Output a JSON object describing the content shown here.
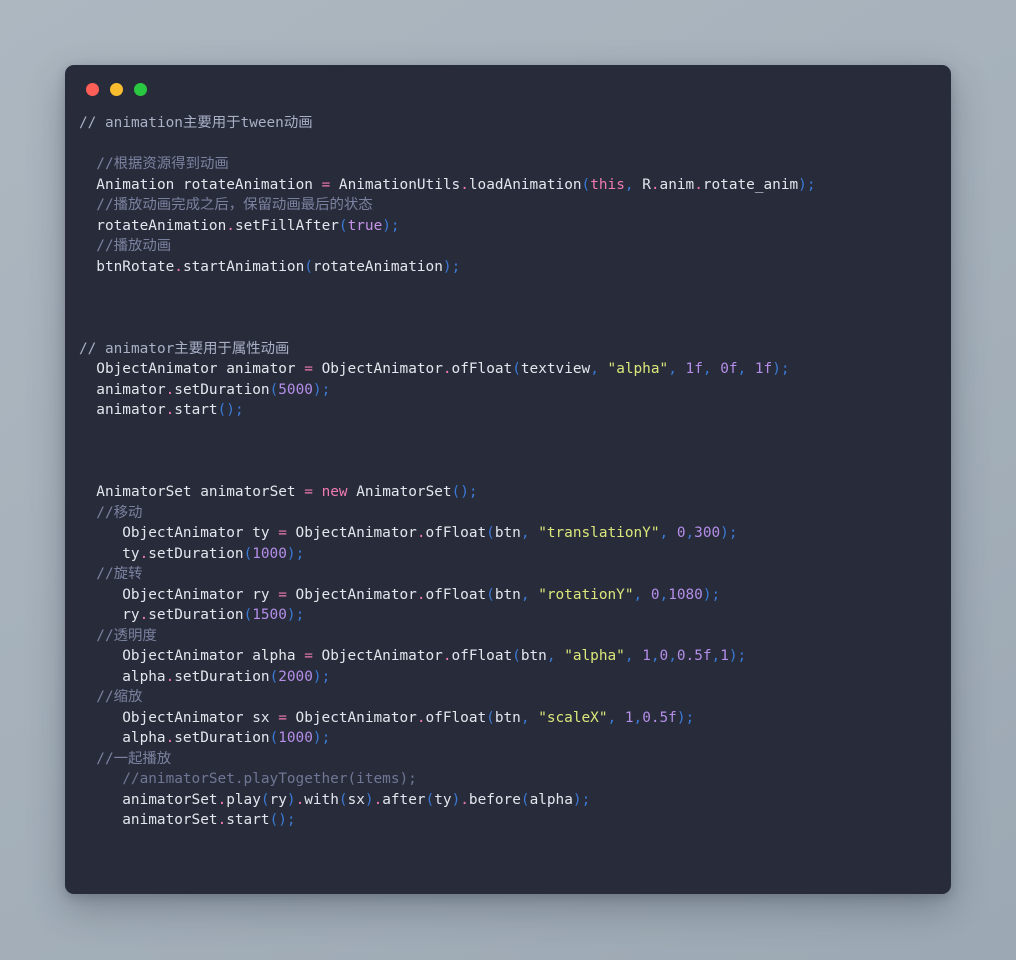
{
  "window": {
    "title": "code-editor-window",
    "traffic_lights": [
      {
        "name": "close-button",
        "color": "#ff5f57"
      },
      {
        "name": "minimize-button",
        "color": "#f7bd2e"
      },
      {
        "name": "maximize-button",
        "color": "#2ac840"
      }
    ],
    "background": "#282c3a",
    "page_background": "#a6b1bb"
  },
  "code": {
    "language": "java",
    "lines": [
      {
        "indent": 0,
        "tokens": [
          {
            "t": "// animation主要用于tween动画",
            "c": "c-comment2"
          }
        ]
      },
      {
        "indent": 0,
        "tokens": []
      },
      {
        "indent": 2,
        "tokens": [
          {
            "t": "//根据资源得到动画",
            "c": "c-comment"
          }
        ]
      },
      {
        "indent": 2,
        "tokens": [
          {
            "t": "Animation",
            "c": "c-plain"
          },
          {
            "t": " rotateAnimation ",
            "c": "c-plain"
          },
          {
            "t": "=",
            "c": "c-op"
          },
          {
            "t": " AnimationUtils",
            "c": "c-plain"
          },
          {
            "t": ".",
            "c": "c-dot"
          },
          {
            "t": "loadAnimation",
            "c": "c-plain"
          },
          {
            "t": "(",
            "c": "c-punct"
          },
          {
            "t": "this",
            "c": "c-kw"
          },
          {
            "t": ",",
            "c": "c-punct"
          },
          {
            "t": " R",
            "c": "c-plain"
          },
          {
            "t": ".",
            "c": "c-dot"
          },
          {
            "t": "anim",
            "c": "c-plain"
          },
          {
            "t": ".",
            "c": "c-dot"
          },
          {
            "t": "rotate_anim",
            "c": "c-plain"
          },
          {
            "t": ")",
            "c": "c-punct"
          },
          {
            "t": ";",
            "c": "c-punct"
          }
        ]
      },
      {
        "indent": 2,
        "tokens": [
          {
            "t": "//播放动画完成之后，保留动画最后的状态",
            "c": "c-comment"
          }
        ]
      },
      {
        "indent": 2,
        "tokens": [
          {
            "t": "rotateAnimation",
            "c": "c-plain"
          },
          {
            "t": ".",
            "c": "c-dot"
          },
          {
            "t": "setFillAfter",
            "c": "c-plain"
          },
          {
            "t": "(",
            "c": "c-punct"
          },
          {
            "t": "true",
            "c": "c-kw2"
          },
          {
            "t": ")",
            "c": "c-punct"
          },
          {
            "t": ";",
            "c": "c-punct"
          }
        ]
      },
      {
        "indent": 2,
        "tokens": [
          {
            "t": "//播放动画",
            "c": "c-comment"
          }
        ]
      },
      {
        "indent": 2,
        "tokens": [
          {
            "t": "btnRotate",
            "c": "c-plain"
          },
          {
            "t": ".",
            "c": "c-dot"
          },
          {
            "t": "startAnimation",
            "c": "c-plain"
          },
          {
            "t": "(",
            "c": "c-punct"
          },
          {
            "t": "rotateAnimation",
            "c": "c-plain"
          },
          {
            "t": ")",
            "c": "c-punct"
          },
          {
            "t": ";",
            "c": "c-punct"
          }
        ]
      },
      {
        "indent": 0,
        "tokens": []
      },
      {
        "indent": 0,
        "tokens": []
      },
      {
        "indent": 0,
        "tokens": []
      },
      {
        "indent": 0,
        "tokens": [
          {
            "t": "// animator主要用于属性动画",
            "c": "c-comment2"
          }
        ]
      },
      {
        "indent": 2,
        "tokens": [
          {
            "t": "ObjectAnimator",
            "c": "c-plain"
          },
          {
            "t": " animator ",
            "c": "c-plain"
          },
          {
            "t": "=",
            "c": "c-op"
          },
          {
            "t": " ObjectAnimator",
            "c": "c-plain"
          },
          {
            "t": ".",
            "c": "c-dot"
          },
          {
            "t": "ofFloat",
            "c": "c-plain"
          },
          {
            "t": "(",
            "c": "c-punct"
          },
          {
            "t": "textview",
            "c": "c-plain"
          },
          {
            "t": ",",
            "c": "c-punct"
          },
          {
            "t": " ",
            "c": "c-plain"
          },
          {
            "t": "\"alpha\"",
            "c": "c-str"
          },
          {
            "t": ",",
            "c": "c-punct"
          },
          {
            "t": " ",
            "c": "c-plain"
          },
          {
            "t": "1f",
            "c": "c-num"
          },
          {
            "t": ",",
            "c": "c-punct"
          },
          {
            "t": " ",
            "c": "c-plain"
          },
          {
            "t": "0f",
            "c": "c-num"
          },
          {
            "t": ",",
            "c": "c-punct"
          },
          {
            "t": " ",
            "c": "c-plain"
          },
          {
            "t": "1f",
            "c": "c-num"
          },
          {
            "t": ")",
            "c": "c-punct"
          },
          {
            "t": ";",
            "c": "c-punct"
          }
        ]
      },
      {
        "indent": 2,
        "tokens": [
          {
            "t": "animator",
            "c": "c-plain"
          },
          {
            "t": ".",
            "c": "c-dot"
          },
          {
            "t": "setDuration",
            "c": "c-plain"
          },
          {
            "t": "(",
            "c": "c-punct"
          },
          {
            "t": "5000",
            "c": "c-num"
          },
          {
            "t": ")",
            "c": "c-punct"
          },
          {
            "t": ";",
            "c": "c-punct"
          }
        ]
      },
      {
        "indent": 2,
        "tokens": [
          {
            "t": "animator",
            "c": "c-plain"
          },
          {
            "t": ".",
            "c": "c-dot"
          },
          {
            "t": "start",
            "c": "c-plain"
          },
          {
            "t": "(",
            "c": "c-punct"
          },
          {
            "t": ")",
            "c": "c-punct"
          },
          {
            "t": ";",
            "c": "c-punct"
          }
        ]
      },
      {
        "indent": 0,
        "tokens": []
      },
      {
        "indent": 0,
        "tokens": []
      },
      {
        "indent": 0,
        "tokens": []
      },
      {
        "indent": 2,
        "tokens": [
          {
            "t": "AnimatorSet",
            "c": "c-plain"
          },
          {
            "t": " animatorSet ",
            "c": "c-plain"
          },
          {
            "t": "=",
            "c": "c-op"
          },
          {
            "t": " ",
            "c": "c-plain"
          },
          {
            "t": "new",
            "c": "c-kw"
          },
          {
            "t": " AnimatorSet",
            "c": "c-plain"
          },
          {
            "t": "(",
            "c": "c-punct"
          },
          {
            "t": ")",
            "c": "c-punct"
          },
          {
            "t": ";",
            "c": "c-punct"
          }
        ]
      },
      {
        "indent": 2,
        "tokens": [
          {
            "t": "//移动",
            "c": "c-comment"
          }
        ]
      },
      {
        "indent": 5,
        "tokens": [
          {
            "t": "ObjectAnimator",
            "c": "c-plain"
          },
          {
            "t": " ty ",
            "c": "c-plain"
          },
          {
            "t": "=",
            "c": "c-op"
          },
          {
            "t": " ObjectAnimator",
            "c": "c-plain"
          },
          {
            "t": ".",
            "c": "c-dot"
          },
          {
            "t": "ofFloat",
            "c": "c-plain"
          },
          {
            "t": "(",
            "c": "c-punct"
          },
          {
            "t": "btn",
            "c": "c-plain"
          },
          {
            "t": ",",
            "c": "c-punct"
          },
          {
            "t": " ",
            "c": "c-plain"
          },
          {
            "t": "\"translationY\"",
            "c": "c-str"
          },
          {
            "t": ",",
            "c": "c-punct"
          },
          {
            "t": " ",
            "c": "c-plain"
          },
          {
            "t": "0",
            "c": "c-num"
          },
          {
            "t": ",",
            "c": "c-punct"
          },
          {
            "t": "300",
            "c": "c-num"
          },
          {
            "t": ")",
            "c": "c-punct"
          },
          {
            "t": ";",
            "c": "c-punct"
          }
        ]
      },
      {
        "indent": 5,
        "tokens": [
          {
            "t": "ty",
            "c": "c-plain"
          },
          {
            "t": ".",
            "c": "c-dot"
          },
          {
            "t": "setDuration",
            "c": "c-plain"
          },
          {
            "t": "(",
            "c": "c-punct"
          },
          {
            "t": "1000",
            "c": "c-num"
          },
          {
            "t": ")",
            "c": "c-punct"
          },
          {
            "t": ";",
            "c": "c-punct"
          }
        ]
      },
      {
        "indent": 2,
        "tokens": [
          {
            "t": "//旋转",
            "c": "c-comment"
          }
        ]
      },
      {
        "indent": 5,
        "tokens": [
          {
            "t": "ObjectAnimator",
            "c": "c-plain"
          },
          {
            "t": " ry ",
            "c": "c-plain"
          },
          {
            "t": "=",
            "c": "c-op"
          },
          {
            "t": " ObjectAnimator",
            "c": "c-plain"
          },
          {
            "t": ".",
            "c": "c-dot"
          },
          {
            "t": "ofFloat",
            "c": "c-plain"
          },
          {
            "t": "(",
            "c": "c-punct"
          },
          {
            "t": "btn",
            "c": "c-plain"
          },
          {
            "t": ",",
            "c": "c-punct"
          },
          {
            "t": " ",
            "c": "c-plain"
          },
          {
            "t": "\"rotationY\"",
            "c": "c-str"
          },
          {
            "t": ",",
            "c": "c-punct"
          },
          {
            "t": " ",
            "c": "c-plain"
          },
          {
            "t": "0",
            "c": "c-num"
          },
          {
            "t": ",",
            "c": "c-punct"
          },
          {
            "t": "1080",
            "c": "c-num"
          },
          {
            "t": ")",
            "c": "c-punct"
          },
          {
            "t": ";",
            "c": "c-punct"
          }
        ]
      },
      {
        "indent": 5,
        "tokens": [
          {
            "t": "ry",
            "c": "c-plain"
          },
          {
            "t": ".",
            "c": "c-dot"
          },
          {
            "t": "setDuration",
            "c": "c-plain"
          },
          {
            "t": "(",
            "c": "c-punct"
          },
          {
            "t": "1500",
            "c": "c-num"
          },
          {
            "t": ")",
            "c": "c-punct"
          },
          {
            "t": ";",
            "c": "c-punct"
          }
        ]
      },
      {
        "indent": 2,
        "tokens": [
          {
            "t": "//透明度",
            "c": "c-comment"
          }
        ]
      },
      {
        "indent": 5,
        "tokens": [
          {
            "t": "ObjectAnimator",
            "c": "c-plain"
          },
          {
            "t": " alpha ",
            "c": "c-plain"
          },
          {
            "t": "=",
            "c": "c-op"
          },
          {
            "t": " ObjectAnimator",
            "c": "c-plain"
          },
          {
            "t": ".",
            "c": "c-dot"
          },
          {
            "t": "ofFloat",
            "c": "c-plain"
          },
          {
            "t": "(",
            "c": "c-punct"
          },
          {
            "t": "btn",
            "c": "c-plain"
          },
          {
            "t": ",",
            "c": "c-punct"
          },
          {
            "t": " ",
            "c": "c-plain"
          },
          {
            "t": "\"alpha\"",
            "c": "c-str"
          },
          {
            "t": ",",
            "c": "c-punct"
          },
          {
            "t": " ",
            "c": "c-plain"
          },
          {
            "t": "1",
            "c": "c-num"
          },
          {
            "t": ",",
            "c": "c-punct"
          },
          {
            "t": "0",
            "c": "c-num"
          },
          {
            "t": ",",
            "c": "c-punct"
          },
          {
            "t": "0.5f",
            "c": "c-num"
          },
          {
            "t": ",",
            "c": "c-punct"
          },
          {
            "t": "1",
            "c": "c-num"
          },
          {
            "t": ")",
            "c": "c-punct"
          },
          {
            "t": ";",
            "c": "c-punct"
          }
        ]
      },
      {
        "indent": 5,
        "tokens": [
          {
            "t": "alpha",
            "c": "c-plain"
          },
          {
            "t": ".",
            "c": "c-dot"
          },
          {
            "t": "setDuration",
            "c": "c-plain"
          },
          {
            "t": "(",
            "c": "c-punct"
          },
          {
            "t": "2000",
            "c": "c-num"
          },
          {
            "t": ")",
            "c": "c-punct"
          },
          {
            "t": ";",
            "c": "c-punct"
          }
        ]
      },
      {
        "indent": 2,
        "tokens": [
          {
            "t": "//缩放",
            "c": "c-comment"
          }
        ]
      },
      {
        "indent": 5,
        "tokens": [
          {
            "t": "ObjectAnimator",
            "c": "c-plain"
          },
          {
            "t": " sx ",
            "c": "c-plain"
          },
          {
            "t": "=",
            "c": "c-op"
          },
          {
            "t": " ObjectAnimator",
            "c": "c-plain"
          },
          {
            "t": ".",
            "c": "c-dot"
          },
          {
            "t": "ofFloat",
            "c": "c-plain"
          },
          {
            "t": "(",
            "c": "c-punct"
          },
          {
            "t": "btn",
            "c": "c-plain"
          },
          {
            "t": ",",
            "c": "c-punct"
          },
          {
            "t": " ",
            "c": "c-plain"
          },
          {
            "t": "\"scaleX\"",
            "c": "c-str"
          },
          {
            "t": ",",
            "c": "c-punct"
          },
          {
            "t": " ",
            "c": "c-plain"
          },
          {
            "t": "1",
            "c": "c-num"
          },
          {
            "t": ",",
            "c": "c-punct"
          },
          {
            "t": "0.5f",
            "c": "c-num"
          },
          {
            "t": ")",
            "c": "c-punct"
          },
          {
            "t": ";",
            "c": "c-punct"
          }
        ]
      },
      {
        "indent": 5,
        "tokens": [
          {
            "t": "alpha",
            "c": "c-plain"
          },
          {
            "t": ".",
            "c": "c-dot"
          },
          {
            "t": "setDuration",
            "c": "c-plain"
          },
          {
            "t": "(",
            "c": "c-punct"
          },
          {
            "t": "1000",
            "c": "c-num"
          },
          {
            "t": ")",
            "c": "c-punct"
          },
          {
            "t": ";",
            "c": "c-punct"
          }
        ]
      },
      {
        "indent": 2,
        "tokens": [
          {
            "t": "//一起播放",
            "c": "c-comment"
          }
        ]
      },
      {
        "indent": 5,
        "tokens": [
          {
            "t": "//animatorSet.playTogether(items);",
            "c": "c-dim"
          }
        ]
      },
      {
        "indent": 5,
        "tokens": [
          {
            "t": "animatorSet",
            "c": "c-plain"
          },
          {
            "t": ".",
            "c": "c-dot"
          },
          {
            "t": "play",
            "c": "c-plain"
          },
          {
            "t": "(",
            "c": "c-punct"
          },
          {
            "t": "ry",
            "c": "c-plain"
          },
          {
            "t": ")",
            "c": "c-punct"
          },
          {
            "t": ".",
            "c": "c-dot"
          },
          {
            "t": "with",
            "c": "c-plain"
          },
          {
            "t": "(",
            "c": "c-punct"
          },
          {
            "t": "sx",
            "c": "c-plain"
          },
          {
            "t": ")",
            "c": "c-punct"
          },
          {
            "t": ".",
            "c": "c-dot"
          },
          {
            "t": "after",
            "c": "c-plain"
          },
          {
            "t": "(",
            "c": "c-punct"
          },
          {
            "t": "ty",
            "c": "c-plain"
          },
          {
            "t": ")",
            "c": "c-punct"
          },
          {
            "t": ".",
            "c": "c-dot"
          },
          {
            "t": "before",
            "c": "c-plain"
          },
          {
            "t": "(",
            "c": "c-punct"
          },
          {
            "t": "alpha",
            "c": "c-plain"
          },
          {
            "t": ")",
            "c": "c-punct"
          },
          {
            "t": ";",
            "c": "c-punct"
          }
        ]
      },
      {
        "indent": 5,
        "tokens": [
          {
            "t": "animatorSet",
            "c": "c-plain"
          },
          {
            "t": ".",
            "c": "c-dot"
          },
          {
            "t": "start",
            "c": "c-plain"
          },
          {
            "t": "(",
            "c": "c-punct"
          },
          {
            "t": ")",
            "c": "c-punct"
          },
          {
            "t": ";",
            "c": "c-punct"
          }
        ]
      }
    ]
  }
}
